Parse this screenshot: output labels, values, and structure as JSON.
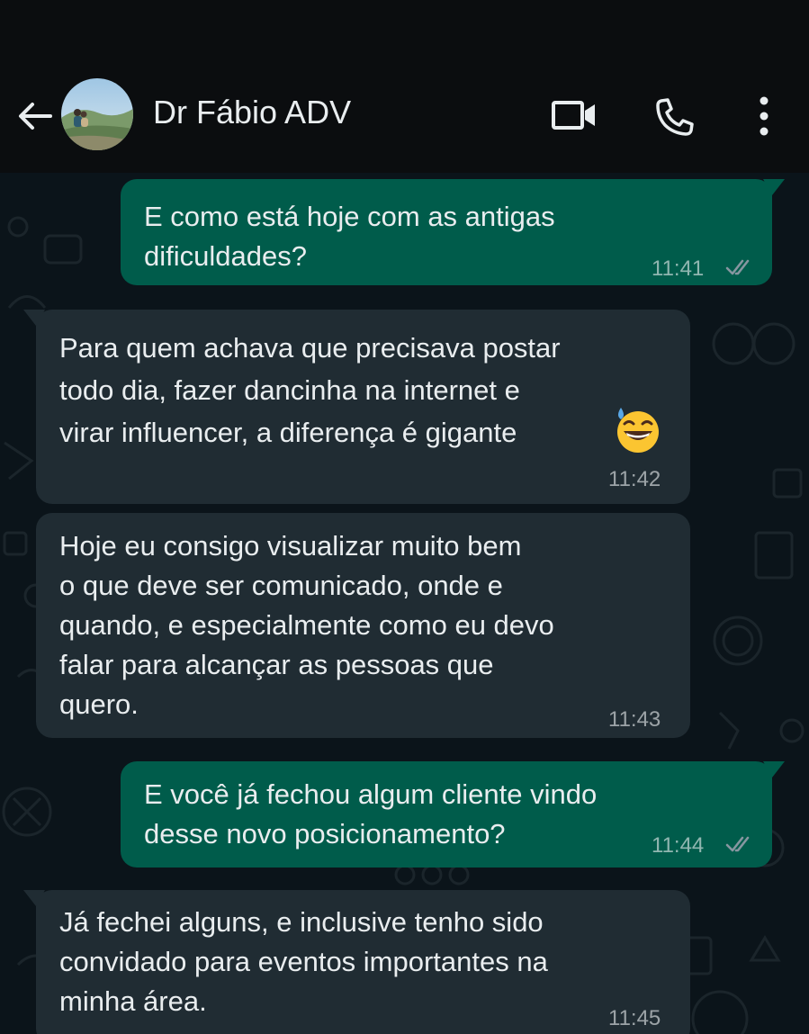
{
  "header": {
    "contact_name": "Dr Fábio ADV",
    "icons": {
      "back": "arrow-left-icon",
      "video": "video-call-icon",
      "call": "phone-icon",
      "menu": "more-vertical-icon"
    }
  },
  "theme": {
    "outgoing_bubble": "#005c4b",
    "incoming_bubble": "#202c33",
    "chat_background": "#0b141a",
    "text": "#e9edef",
    "read_ticks": "#8696a0"
  },
  "messages": [
    {
      "direction": "outgoing",
      "text": "E como está hoje com as antigas\ndificuldades?",
      "time": "11:41",
      "status": "delivered"
    },
    {
      "direction": "incoming",
      "text": "Para quem achava que precisava postar\ntodo dia, fazer dancinha na internet e\nvirar influencer, a diferença é gigante",
      "emoji": "grinning-face-with-sweat",
      "time": "11:42"
    },
    {
      "direction": "incoming",
      "text": "Hoje eu consigo visualizar muito bem\no que deve ser comunicado, onde e\nquando, e especialmente como eu devo\nfalar para alcançar as pessoas que\nquero.",
      "time": "11:43"
    },
    {
      "direction": "outgoing",
      "text": "E você já fechou algum cliente vindo\ndesse novo posicionamento?",
      "time": "11:44",
      "status": "delivered"
    },
    {
      "direction": "incoming",
      "text": "Já fechei alguns, e inclusive tenho sido\nconvidado para eventos importantes na\nminha área.",
      "time": "11:45"
    }
  ]
}
